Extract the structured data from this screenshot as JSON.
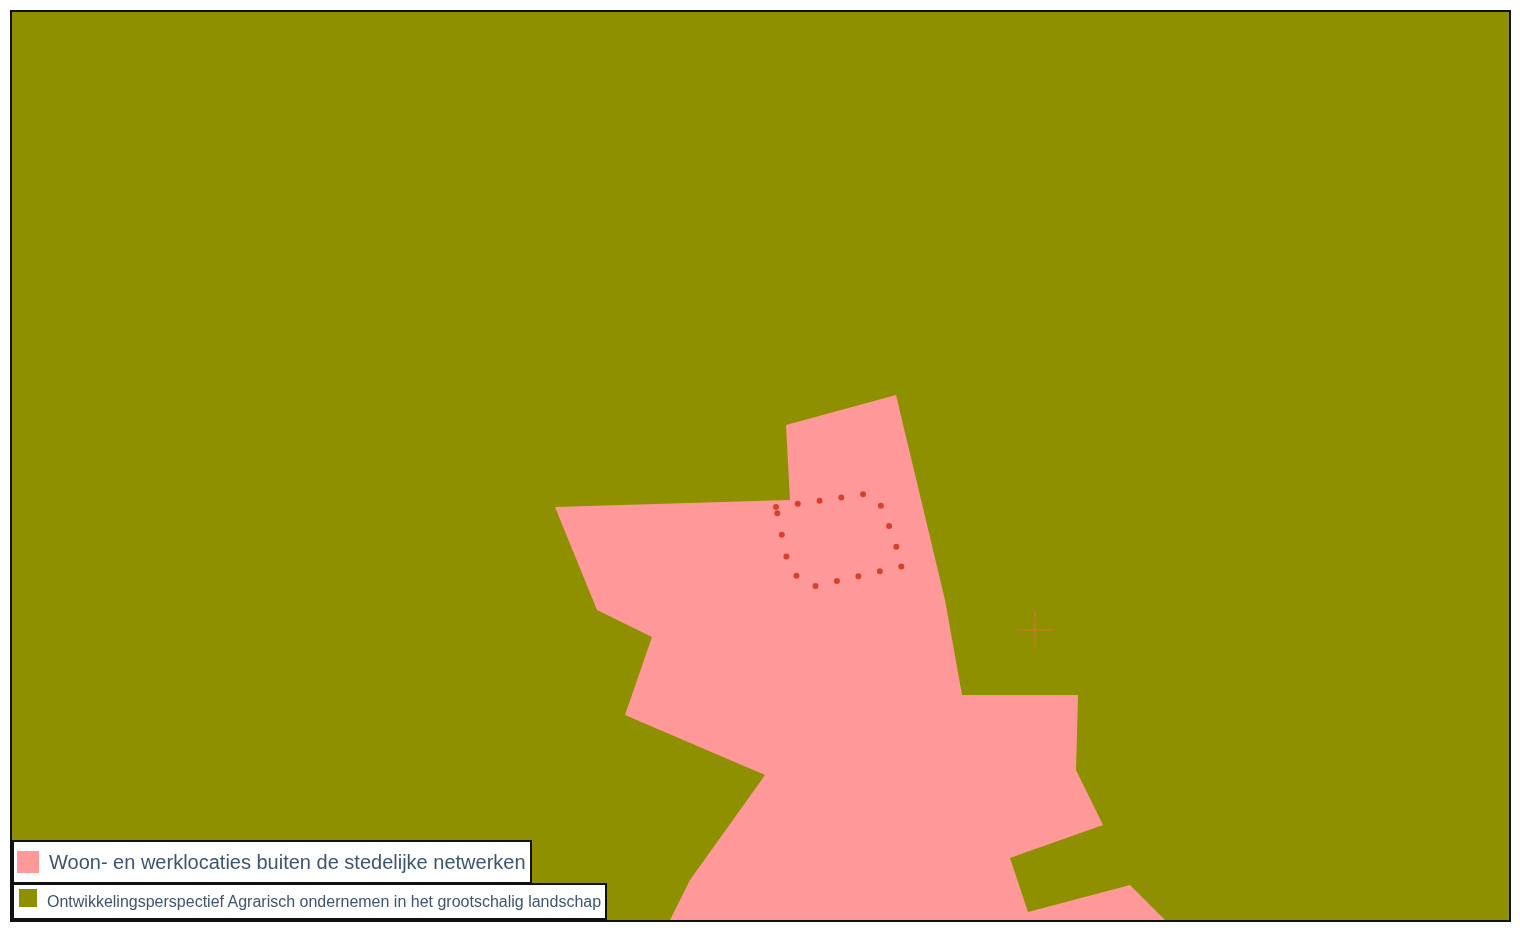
{
  "map": {
    "legend": [
      {
        "label": "Woon- en werklocaties buiten de stedelijke netwerken",
        "color": "#ff9999",
        "kind": "large"
      },
      {
        "label": "Ontwikkelingsperspectief Agrarisch ondernemen in het grootschalig landschap",
        "color": "#8f9000",
        "kind": "small"
      }
    ]
  }
}
